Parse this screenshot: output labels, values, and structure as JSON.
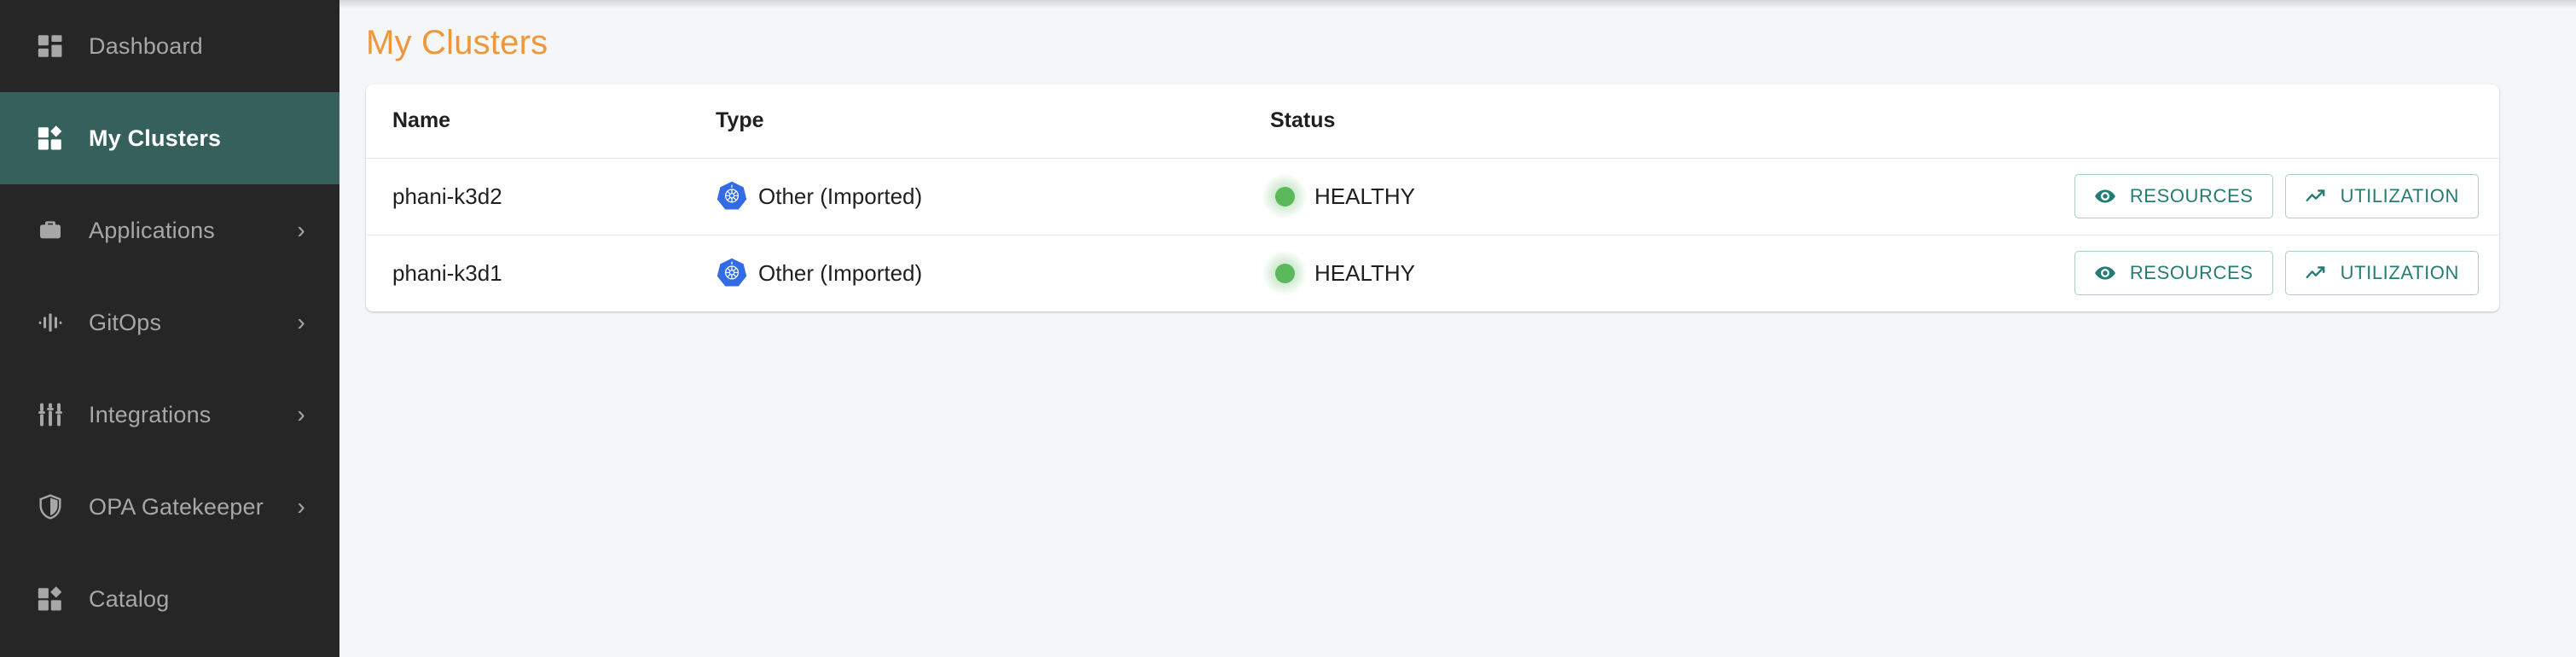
{
  "sidebar": {
    "items": [
      {
        "label": "Dashboard",
        "icon": "dashboard-grid-icon",
        "active": false,
        "chevron": false
      },
      {
        "label": "My Clusters",
        "icon": "clusters-icon",
        "active": true,
        "chevron": false
      },
      {
        "label": "Applications",
        "icon": "briefcase-icon",
        "active": false,
        "chevron": true
      },
      {
        "label": "GitOps",
        "icon": "waveform-icon",
        "active": false,
        "chevron": true
      },
      {
        "label": "Integrations",
        "icon": "sliders-icon",
        "active": false,
        "chevron": true
      },
      {
        "label": "OPA Gatekeeper",
        "icon": "shield-icon",
        "active": false,
        "chevron": true
      },
      {
        "label": "Catalog",
        "icon": "catalog-icon",
        "active": false,
        "chevron": false
      }
    ],
    "chevron_glyph": "›",
    "active_color": "#36605c",
    "background_color": "#262626",
    "text_color": "#a7a7a7"
  },
  "page": {
    "title": "My Clusters",
    "title_color": "#f0973a"
  },
  "table": {
    "headers": [
      "Name",
      "Type",
      "Status",
      ""
    ],
    "rows": [
      {
        "name": "phani-k3d2",
        "type": "Other (Imported)",
        "type_icon": "kubernetes-icon",
        "status": "HEALTHY",
        "status_color": "#5cb85c",
        "actions": [
          {
            "label": "RESOURCES",
            "icon": "eye-icon"
          },
          {
            "label": "UTILIZATION",
            "icon": "trending-up-icon"
          }
        ]
      },
      {
        "name": "phani-k3d1",
        "type": "Other (Imported)",
        "type_icon": "kubernetes-icon",
        "status": "HEALTHY",
        "status_color": "#5cb85c",
        "actions": [
          {
            "label": "RESOURCES",
            "icon": "eye-icon"
          },
          {
            "label": "UTILIZATION",
            "icon": "trending-up-icon"
          }
        ]
      }
    ],
    "action_accent_color": "#247d73"
  }
}
